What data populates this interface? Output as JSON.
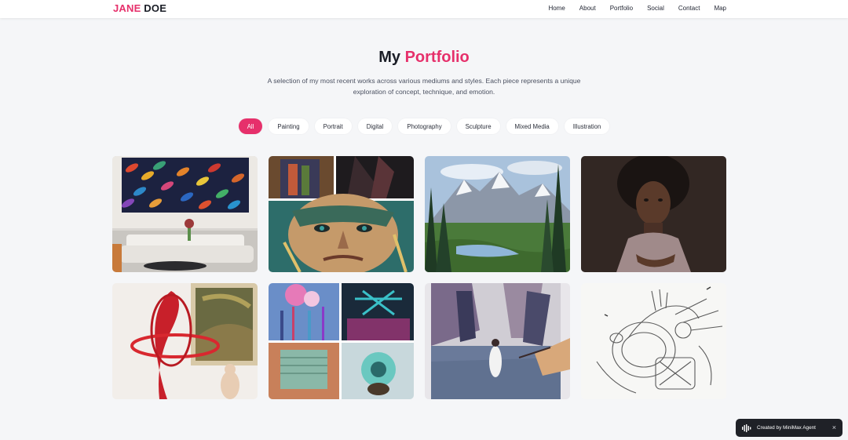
{
  "header": {
    "logo_first": "JANE",
    "logo_last": "DOE",
    "nav": [
      "Home",
      "About",
      "Portfolio",
      "Social",
      "Contact",
      "Map"
    ]
  },
  "hero": {
    "title_plain": "My",
    "title_accent": "Portfolio",
    "subtitle": "A selection of my most recent works across various mediums and styles. Each piece represents a unique exploration of concept, technique, and emotion."
  },
  "filters": {
    "active": "All",
    "items": [
      "All",
      "Painting",
      "Portrait",
      "Digital",
      "Photography",
      "Sculpture",
      "Mixed Media",
      "Illustration"
    ]
  },
  "gallery": [
    {
      "subject": "abstract-feather-painting-in-living-room"
    },
    {
      "subject": "expressive-portrait-collage"
    },
    {
      "subject": "mountain-landscape-painting"
    },
    {
      "subject": "portrait-photograph"
    },
    {
      "subject": "red-ribbon-sculpture"
    },
    {
      "subject": "mixed-media-collage"
    },
    {
      "subject": "watercolor-city-scene"
    },
    {
      "subject": "pencil-sketch-illustration"
    }
  ],
  "badge": {
    "text": "Created by MiniMax Agent",
    "close": "×"
  },
  "colors": {
    "accent": "#e6306b",
    "background": "#f5f6f8",
    "badge": "#1f2127"
  }
}
